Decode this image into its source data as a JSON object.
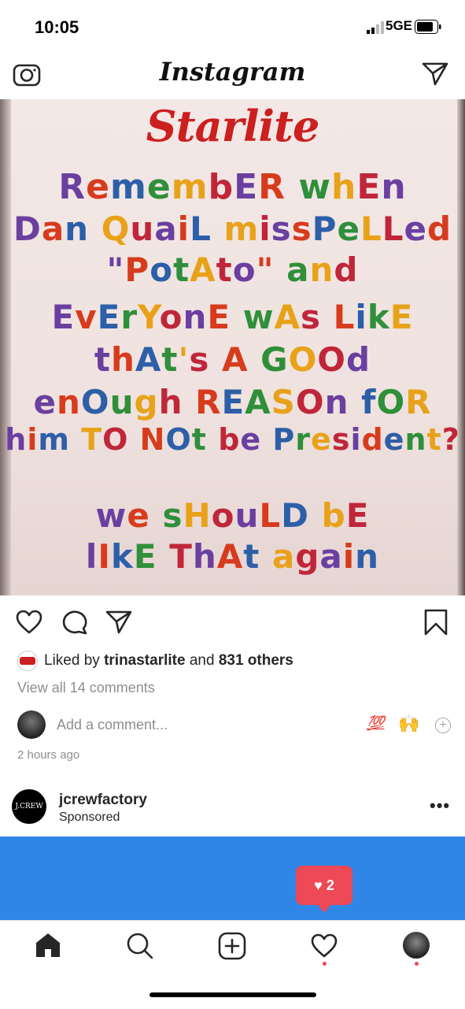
{
  "status": {
    "time": "10:05",
    "network": "5GE"
  },
  "header": {
    "logo": "Instagram"
  },
  "post": {
    "image_text": {
      "brand": "Starlite",
      "lines": [
        "RemembER whEn",
        "Dan QuaiL missPeLLed",
        "\"PotAto\" and",
        "EvErYonE wAs LikE",
        "thAt's A GOOd",
        "enOugh REASOn fOR",
        "him TO NOt be President?",
        "we sHouLD bE",
        "lIkE ThAt again"
      ]
    },
    "likes": {
      "prefix": "Liked by",
      "user": "trinastarlite",
      "and": "and",
      "others": "831 others"
    },
    "view_comments": "View all 14 comments",
    "add_comment_placeholder": "Add a comment...",
    "quick_emoji_1": "💯",
    "quick_emoji_2": "🙌",
    "time_ago": "2 hours ago"
  },
  "sponsored": {
    "username": "jcrewfactory",
    "label": "Sponsored",
    "logo_text": "J.CREW",
    "more": "•••"
  },
  "notification": {
    "count": "2"
  }
}
